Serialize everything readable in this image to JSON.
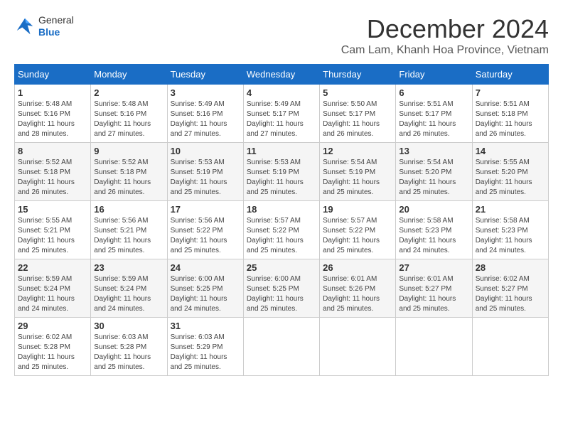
{
  "header": {
    "logo_general": "General",
    "logo_blue": "Blue",
    "month_title": "December 2024",
    "subtitle": "Cam Lam, Khanh Hoa Province, Vietnam"
  },
  "days_of_week": [
    "Sunday",
    "Monday",
    "Tuesday",
    "Wednesday",
    "Thursday",
    "Friday",
    "Saturday"
  ],
  "weeks": [
    [
      {
        "day": "1",
        "sunrise": "Sunrise: 5:48 AM",
        "sunset": "Sunset: 5:16 PM",
        "daylight": "Daylight: 11 hours and 28 minutes."
      },
      {
        "day": "2",
        "sunrise": "Sunrise: 5:48 AM",
        "sunset": "Sunset: 5:16 PM",
        "daylight": "Daylight: 11 hours and 27 minutes."
      },
      {
        "day": "3",
        "sunrise": "Sunrise: 5:49 AM",
        "sunset": "Sunset: 5:16 PM",
        "daylight": "Daylight: 11 hours and 27 minutes."
      },
      {
        "day": "4",
        "sunrise": "Sunrise: 5:49 AM",
        "sunset": "Sunset: 5:17 PM",
        "daylight": "Daylight: 11 hours and 27 minutes."
      },
      {
        "day": "5",
        "sunrise": "Sunrise: 5:50 AM",
        "sunset": "Sunset: 5:17 PM",
        "daylight": "Daylight: 11 hours and 26 minutes."
      },
      {
        "day": "6",
        "sunrise": "Sunrise: 5:51 AM",
        "sunset": "Sunset: 5:17 PM",
        "daylight": "Daylight: 11 hours and 26 minutes."
      },
      {
        "day": "7",
        "sunrise": "Sunrise: 5:51 AM",
        "sunset": "Sunset: 5:18 PM",
        "daylight": "Daylight: 11 hours and 26 minutes."
      }
    ],
    [
      {
        "day": "8",
        "sunrise": "Sunrise: 5:52 AM",
        "sunset": "Sunset: 5:18 PM",
        "daylight": "Daylight: 11 hours and 26 minutes."
      },
      {
        "day": "9",
        "sunrise": "Sunrise: 5:52 AM",
        "sunset": "Sunset: 5:18 PM",
        "daylight": "Daylight: 11 hours and 26 minutes."
      },
      {
        "day": "10",
        "sunrise": "Sunrise: 5:53 AM",
        "sunset": "Sunset: 5:19 PM",
        "daylight": "Daylight: 11 hours and 25 minutes."
      },
      {
        "day": "11",
        "sunrise": "Sunrise: 5:53 AM",
        "sunset": "Sunset: 5:19 PM",
        "daylight": "Daylight: 11 hours and 25 minutes."
      },
      {
        "day": "12",
        "sunrise": "Sunrise: 5:54 AM",
        "sunset": "Sunset: 5:19 PM",
        "daylight": "Daylight: 11 hours and 25 minutes."
      },
      {
        "day": "13",
        "sunrise": "Sunrise: 5:54 AM",
        "sunset": "Sunset: 5:20 PM",
        "daylight": "Daylight: 11 hours and 25 minutes."
      },
      {
        "day": "14",
        "sunrise": "Sunrise: 5:55 AM",
        "sunset": "Sunset: 5:20 PM",
        "daylight": "Daylight: 11 hours and 25 minutes."
      }
    ],
    [
      {
        "day": "15",
        "sunrise": "Sunrise: 5:55 AM",
        "sunset": "Sunset: 5:21 PM",
        "daylight": "Daylight: 11 hours and 25 minutes."
      },
      {
        "day": "16",
        "sunrise": "Sunrise: 5:56 AM",
        "sunset": "Sunset: 5:21 PM",
        "daylight": "Daylight: 11 hours and 25 minutes."
      },
      {
        "day": "17",
        "sunrise": "Sunrise: 5:56 AM",
        "sunset": "Sunset: 5:22 PM",
        "daylight": "Daylight: 11 hours and 25 minutes."
      },
      {
        "day": "18",
        "sunrise": "Sunrise: 5:57 AM",
        "sunset": "Sunset: 5:22 PM",
        "daylight": "Daylight: 11 hours and 25 minutes."
      },
      {
        "day": "19",
        "sunrise": "Sunrise: 5:57 AM",
        "sunset": "Sunset: 5:22 PM",
        "daylight": "Daylight: 11 hours and 25 minutes."
      },
      {
        "day": "20",
        "sunrise": "Sunrise: 5:58 AM",
        "sunset": "Sunset: 5:23 PM",
        "daylight": "Daylight: 11 hours and 24 minutes."
      },
      {
        "day": "21",
        "sunrise": "Sunrise: 5:58 AM",
        "sunset": "Sunset: 5:23 PM",
        "daylight": "Daylight: 11 hours and 24 minutes."
      }
    ],
    [
      {
        "day": "22",
        "sunrise": "Sunrise: 5:59 AM",
        "sunset": "Sunset: 5:24 PM",
        "daylight": "Daylight: 11 hours and 24 minutes."
      },
      {
        "day": "23",
        "sunrise": "Sunrise: 5:59 AM",
        "sunset": "Sunset: 5:24 PM",
        "daylight": "Daylight: 11 hours and 24 minutes."
      },
      {
        "day": "24",
        "sunrise": "Sunrise: 6:00 AM",
        "sunset": "Sunset: 5:25 PM",
        "daylight": "Daylight: 11 hours and 24 minutes."
      },
      {
        "day": "25",
        "sunrise": "Sunrise: 6:00 AM",
        "sunset": "Sunset: 5:25 PM",
        "daylight": "Daylight: 11 hours and 25 minutes."
      },
      {
        "day": "26",
        "sunrise": "Sunrise: 6:01 AM",
        "sunset": "Sunset: 5:26 PM",
        "daylight": "Daylight: 11 hours and 25 minutes."
      },
      {
        "day": "27",
        "sunrise": "Sunrise: 6:01 AM",
        "sunset": "Sunset: 5:27 PM",
        "daylight": "Daylight: 11 hours and 25 minutes."
      },
      {
        "day": "28",
        "sunrise": "Sunrise: 6:02 AM",
        "sunset": "Sunset: 5:27 PM",
        "daylight": "Daylight: 11 hours and 25 minutes."
      }
    ],
    [
      {
        "day": "29",
        "sunrise": "Sunrise: 6:02 AM",
        "sunset": "Sunset: 5:28 PM",
        "daylight": "Daylight: 11 hours and 25 minutes."
      },
      {
        "day": "30",
        "sunrise": "Sunrise: 6:03 AM",
        "sunset": "Sunset: 5:28 PM",
        "daylight": "Daylight: 11 hours and 25 minutes."
      },
      {
        "day": "31",
        "sunrise": "Sunrise: 6:03 AM",
        "sunset": "Sunset: 5:29 PM",
        "daylight": "Daylight: 11 hours and 25 minutes."
      },
      {
        "day": "",
        "sunrise": "",
        "sunset": "",
        "daylight": ""
      },
      {
        "day": "",
        "sunrise": "",
        "sunset": "",
        "daylight": ""
      },
      {
        "day": "",
        "sunrise": "",
        "sunset": "",
        "daylight": ""
      },
      {
        "day": "",
        "sunrise": "",
        "sunset": "",
        "daylight": ""
      }
    ]
  ]
}
